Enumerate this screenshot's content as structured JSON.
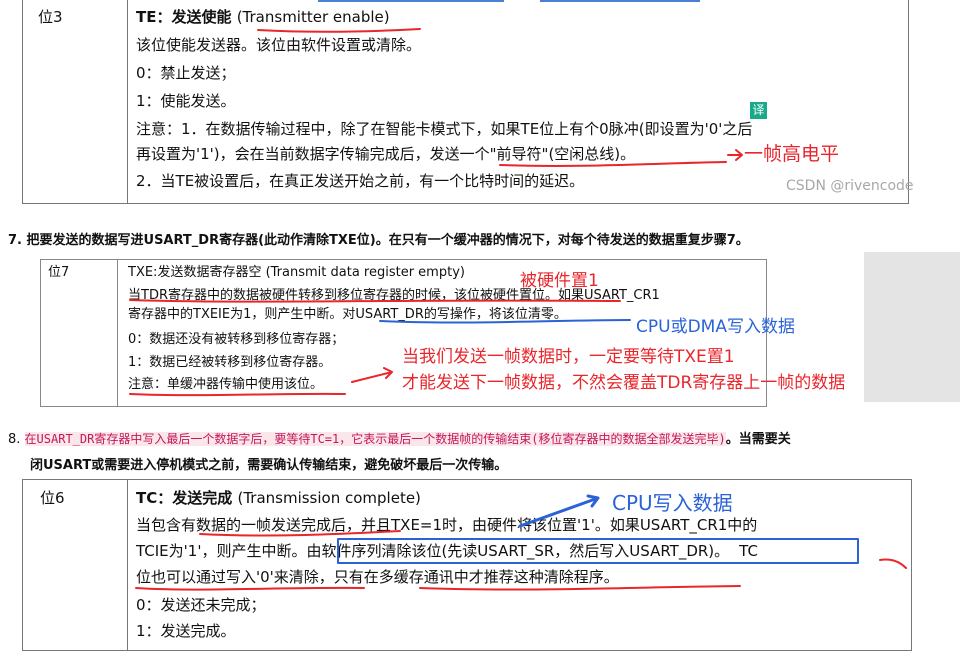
{
  "sec1": {
    "bit": "位3",
    "title_a": "TE：发送使能 ",
    "title_b": "(Transmitter enable)",
    "desc": "该位使能发送器。该位由软件设置或清除。",
    "opt0": "0：禁止发送；",
    "opt1": "1：使能发送。",
    "note1": "注意：1．在数据传输过程中，除了在智能卡模式下，如果TE位上有个0脉冲(即设置为'0'之后",
    "note2": "再设置为'1')，会在当前数据字传输完成后，发送一个\"前导符\"(空闲总线)。",
    "note3": "2．当TE被设置后，在真正发送开始之前，有一个比特时间的延迟。",
    "annotation": "一帧高电平",
    "translate_badge": "译",
    "watermark": "CSDN @rivencode"
  },
  "step7": {
    "text": "7. 把要发送的数据写进USART_DR寄存器(此动作清除TXE位)。在只有一个缓冲器的情况下，对每个待发送的数据重复步骤7。"
  },
  "sec2": {
    "bit": "位7",
    "title": "TXE:发送数据寄存器空 (Transmit data register empty)",
    "l1": "当TDR寄存器中的数据被硬件转移到移位寄存器的时候，该位被硬件置位。如果USART_CR1",
    "l2": "寄存器中的TXEIE为1，则产生中断。对USART_DR的写操作，将该位清零。",
    "l3": "0：数据还没有被转移到移位寄存器；",
    "l4": "1：数据已经被转移到移位寄存器。",
    "l5": "注意：单缓冲器传输中使用该位。",
    "ann_set": "被硬件置1",
    "ann_cpu": "CPU或DMA写入数据",
    "ann_wait1": "当我们发送一帧数据时，一定要等待TXE置1",
    "ann_wait2": "才能发送下一帧数据，不然会覆盖TDR寄存器上一帧的数据"
  },
  "step8": {
    "num": "8.",
    "highlight": "在USART_DR寄存器中写入最后一个数据字后，要等待TC=1，它表示最后一个数据帧的传输结束(移位寄存器中的数据全部发送完毕)",
    "rest1": "。当需要关",
    "rest2": "闭USART或需要进入停机模式之前，需要确认传输结束，避免破坏最后一次传输。"
  },
  "sec3": {
    "bit": "位6",
    "title_a": "TC：发送完成 ",
    "title_b": "(Transmission complete)",
    "l1": "当包含有数据的一帧发送完成后，并且TXE=1时，由硬件将该位置'1'。如果USART_CR1中的",
    "l2a": "TCIE为'1'，则产生中断。",
    "l2b": "由软件序列清除该位(先读USART_SR，然后写入USART_DR)。",
    "l2c": "TC",
    "l3": "位也可以通过写入'0'来清除，只有在多缓存通讯中才推荐这种清除程序。",
    "l4": "0：发送还未完成；",
    "l5": "1：发送完成。",
    "ann_cpu": "CPU写入数据"
  },
  "colors": {
    "annotation_red": "#e8262b",
    "annotation_blue": "#2b63d6"
  }
}
